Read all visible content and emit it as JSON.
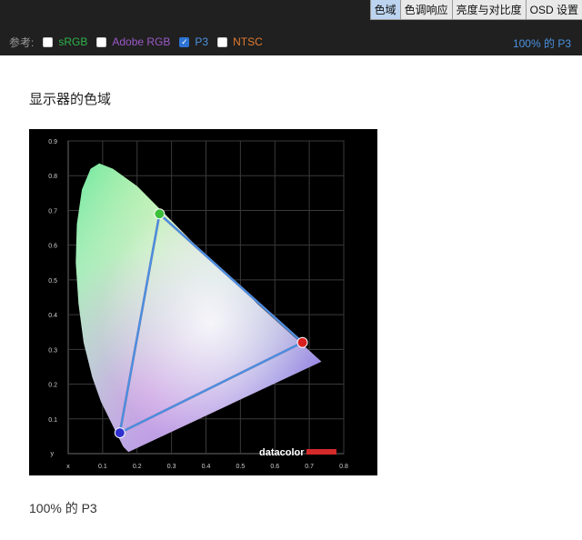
{
  "tabs": [
    {
      "label": "色域",
      "active": true
    },
    {
      "label": "色调响应",
      "active": false
    },
    {
      "label": "亮度与对比度",
      "active": false
    },
    {
      "label": "OSD 设置",
      "active": false
    }
  ],
  "reference": {
    "label": "参考:",
    "options": [
      {
        "label": "sRGB",
        "checked": false,
        "color": "#2fb34a"
      },
      {
        "label": "Adobe RGB",
        "checked": false,
        "color": "#9b59c8"
      },
      {
        "label": "P3",
        "checked": true,
        "color": "#4a92e0"
      },
      {
        "label": "NTSC",
        "checked": false,
        "color": "#e07b30"
      }
    ],
    "status": "100% 的 P3"
  },
  "section_title": "显示器的色域",
  "chart_data": {
    "type": "scatter",
    "xlabel": "x",
    "ylabel": "y",
    "xlim": [
      0,
      0.8
    ],
    "ylim": [
      0,
      0.9
    ],
    "x_ticks": [
      "0.1",
      "0.2",
      "0.3",
      "0.4",
      "0.5",
      "0.6",
      "0.7",
      "0.8"
    ],
    "y_ticks": [
      "0.1",
      "0.2",
      "0.3",
      "0.4",
      "0.5",
      "0.6",
      "0.7",
      "0.8",
      "0.9"
    ],
    "grid": true,
    "series": [
      {
        "kind": "gamut",
        "color": "#e83a3a",
        "points": [
          [
            0.68,
            0.32
          ],
          [
            0.265,
            0.69
          ],
          [
            0.15,
            0.06
          ]
        ]
      },
      {
        "kind": "gamut",
        "color": "#4a8fe0",
        "points": [
          [
            0.68,
            0.32
          ],
          [
            0.265,
            0.69
          ],
          [
            0.15,
            0.06
          ]
        ]
      }
    ],
    "brand": "datacolor"
  },
  "caption": "100% 的 P3"
}
